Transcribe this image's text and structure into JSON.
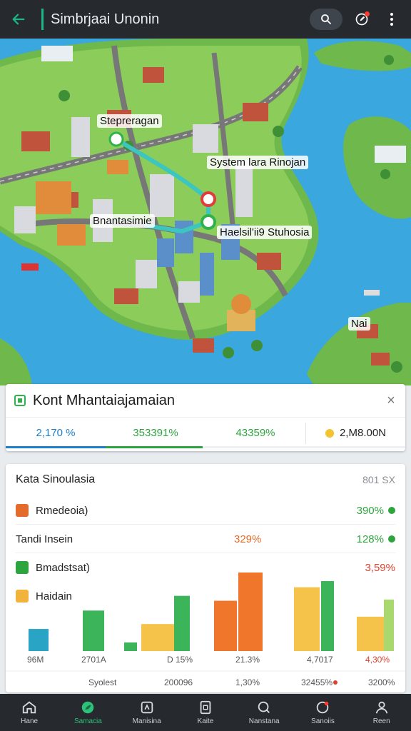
{
  "app": {
    "title": "Simbrjaai Unonin"
  },
  "map": {
    "labels": [
      "Stepreragan",
      "System lara Rinojan",
      "Bnantasimie",
      "Haelsil'ii9 Stuhosia",
      "Nai"
    ]
  },
  "route": {
    "title": "Kont Mhantaiajamaian",
    "close": "×",
    "stats": [
      "2,170 %",
      "353391%",
      "43359%",
      "2,M8.00N"
    ],
    "progress": 0.49
  },
  "panel": {
    "title": "Kata Sinoulasia",
    "meta": "801 SX",
    "rows": [
      {
        "label": "Rmedeoia)",
        "mid": "",
        "value": "390%",
        "color": "#2ea43e",
        "icon_color": "#e36b2c"
      },
      {
        "label": "Tandi Insein",
        "mid": "329%",
        "value": "128%",
        "color": "#2ea43e",
        "mid_color": "#e36b2c",
        "icon_color": ""
      },
      {
        "label": "Bmadstsat)",
        "mid": "",
        "value": "3,59%",
        "color": "#d9432f",
        "icon_color": "#2ea43e"
      },
      {
        "label": "Haidain",
        "mid": "",
        "value": "",
        "color": "#222",
        "icon_color": "#f2b33d"
      }
    ],
    "chart_data": {
      "type": "bar",
      "bars": [
        {
          "value": 18,
          "color": "#2aa4c4"
        },
        {
          "value": 33,
          "color": "#3bb45a"
        },
        {
          "value": 7,
          "color": "#3bb45a"
        },
        {
          "value": 22,
          "color": "#f6c34a"
        },
        {
          "value": 45,
          "color": "#3bb45a"
        },
        {
          "value": 41,
          "color": "#f0762b"
        },
        {
          "value": 64,
          "color": "#f0762b"
        },
        {
          "value": 52,
          "color": "#f6c34a"
        },
        {
          "value": 57,
          "color": "#3bb45a"
        },
        {
          "value": 28,
          "color": "#f6c34a"
        },
        {
          "value": 42,
          "color": "#a9d86e"
        }
      ],
      "x_labels": [
        "96M",
        "2701A",
        "D 15%",
        "21.3%",
        "4,7017",
        "4,30%"
      ],
      "footer": [
        "Syolest",
        "200096",
        "1,30%",
        "32455%",
        "3200%"
      ]
    }
  },
  "nav": {
    "items": [
      {
        "label": "Hane",
        "icon": "home-icon"
      },
      {
        "label": "Samacia",
        "icon": "leaf-icon"
      },
      {
        "label": "Manisina",
        "icon": "map-icon"
      },
      {
        "label": "Kaite",
        "icon": "card-icon"
      },
      {
        "label": "Nanstana",
        "icon": "search-icon"
      },
      {
        "label": "Sanoiis",
        "icon": "gear-icon"
      },
      {
        "label": "Reen",
        "icon": "profile-icon"
      }
    ],
    "active": 1
  }
}
